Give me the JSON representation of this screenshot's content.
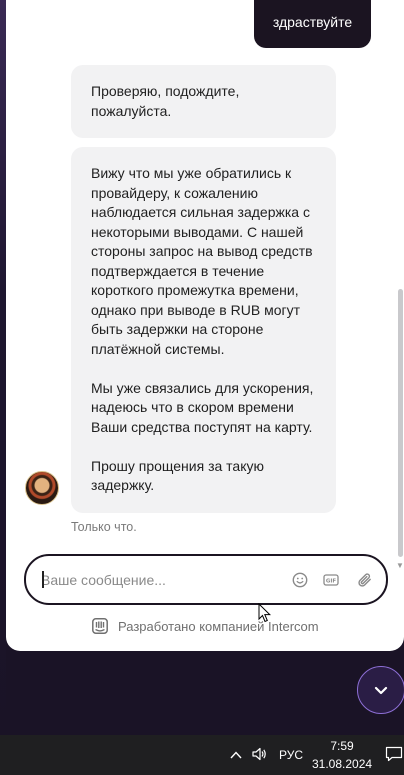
{
  "chat": {
    "user_message": "здраствуйте",
    "agent_messages": [
      "Проверяю, подождите,\nпожалуйста.",
      "Вижу что мы уже обратились к\nпровайдеру, к сожалению\nнаблюдается сильная задержка с\nнекоторыми выводами. С нашей\nстороны запрос на вывод средств\nподтверждается в течение\nкороткого промежутка времени,\nоднако при выводе в RUB могут\nбыть задержки на стороне\nплатёжной системы.\n\nМы уже связались для ускорения,\nнадеюсь что в скором времени\nВаши средства поступят на карту.\n\nПрошу прощения за такую\nзадержку."
    ],
    "timestamp": "Только что."
  },
  "composer": {
    "placeholder": "Ваше сообщение...",
    "icons": [
      "emoji-icon",
      "gif-icon",
      "attachment-icon"
    ]
  },
  "footer": {
    "text": "Разработано компанией Intercom"
  },
  "launcher": {
    "icon": "chevron-down-icon"
  },
  "taskbar": {
    "language": "РУС",
    "time": "7:59",
    "date": "31.08.2024"
  },
  "colors": {
    "user_bubble": "#1b1421",
    "agent_bubble": "#f2f2f3",
    "launcher_border": "#8d6fd6",
    "taskbar": "#1f1f21"
  }
}
